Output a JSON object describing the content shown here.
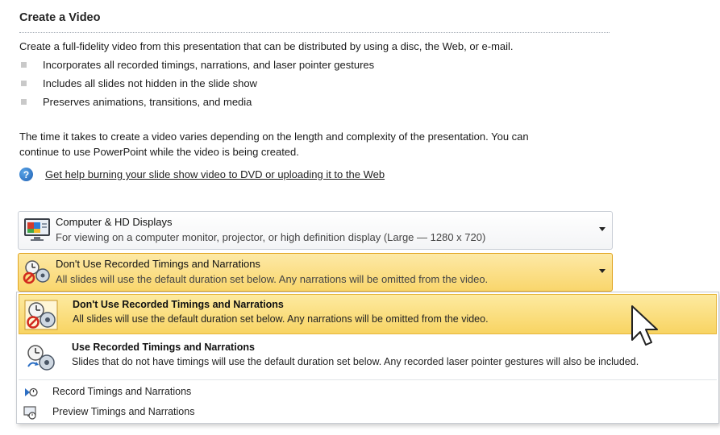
{
  "panel": {
    "title": "Create a Video",
    "intro": "Create a full-fidelity video from this presentation that can be distributed by using a disc, the Web, or e-mail.",
    "bullets": [
      "Incorporates all recorded timings, narrations, and laser pointer gestures",
      "Includes all slides not hidden in the slide show",
      "Preserves animations, transitions, and media"
    ],
    "para_line1": "The time it takes to create a video varies depending on the length and complexity of the presentation. You can",
    "para_line2": "continue to use PowerPoint while the video is being created.",
    "help_link": "Get help burning your slide show video to DVD or uploading it to the Web"
  },
  "quality_dropdown": {
    "title": "Computer & HD Displays",
    "subtitle": "For viewing on a computer monitor, projector, or high definition display  (Large — 1280 x 720)",
    "icon": "monitor-icon"
  },
  "timings_dropdown": {
    "title": "Don't Use Recorded Timings and Narrations",
    "subtitle": "All slides will use the default duration set below. Any narrations will be omitted from the video.",
    "icon": "no-timings-icon"
  },
  "menu": {
    "options": [
      {
        "title": "Don't Use Recorded Timings and Narrations",
        "subtitle": "All slides will use the default duration set below. Any narrations will be omitted from the video.",
        "icon": "no-timings-icon",
        "selected": true
      },
      {
        "title": "Use Recorded Timings and Narrations",
        "subtitle": "Slides that do not have timings will use the default duration set below. Any recorded laser pointer gestures will also be included.",
        "icon": "use-timings-icon",
        "selected": false
      }
    ],
    "commands": [
      {
        "label": "Record Timings and Narrations",
        "icon": "record-icon"
      },
      {
        "label": "Preview Timings and Narrations",
        "icon": "preview-icon"
      }
    ]
  },
  "colors": {
    "highlight": "#f8d463",
    "highlight_border": "#e6b53a",
    "help_blue": "#1f5fb3"
  }
}
